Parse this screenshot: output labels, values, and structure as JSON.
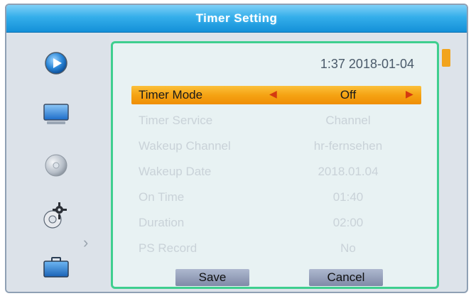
{
  "title": "Timer Setting",
  "clock": "1:37 2018-01-04",
  "sidebar": {
    "items": [
      {
        "icon": "play-icon"
      },
      {
        "icon": "monitor-icon"
      },
      {
        "icon": "disc-icon"
      },
      {
        "icon": "gear-icon"
      },
      {
        "icon": "toolbox-icon"
      }
    ],
    "selected_index": 3
  },
  "rows": [
    {
      "label": "Timer Mode",
      "value": "Off"
    },
    {
      "label": "Timer Service",
      "value": "Channel"
    },
    {
      "label": "Wakeup Channel",
      "value": "hr-fernsehen"
    },
    {
      "label": "Wakeup Date",
      "value": "2018.01.04"
    },
    {
      "label": "On Time",
      "value": "01:40"
    },
    {
      "label": "Duration",
      "value": "02:00"
    },
    {
      "label": "PS Record",
      "value": "No"
    }
  ],
  "selected_row": 0,
  "buttons": {
    "save": "Save",
    "cancel": "Cancel"
  },
  "colors": {
    "accent": "#f5a313",
    "panel_border": "#3fcf8f",
    "title_bar": "#34aeea"
  }
}
